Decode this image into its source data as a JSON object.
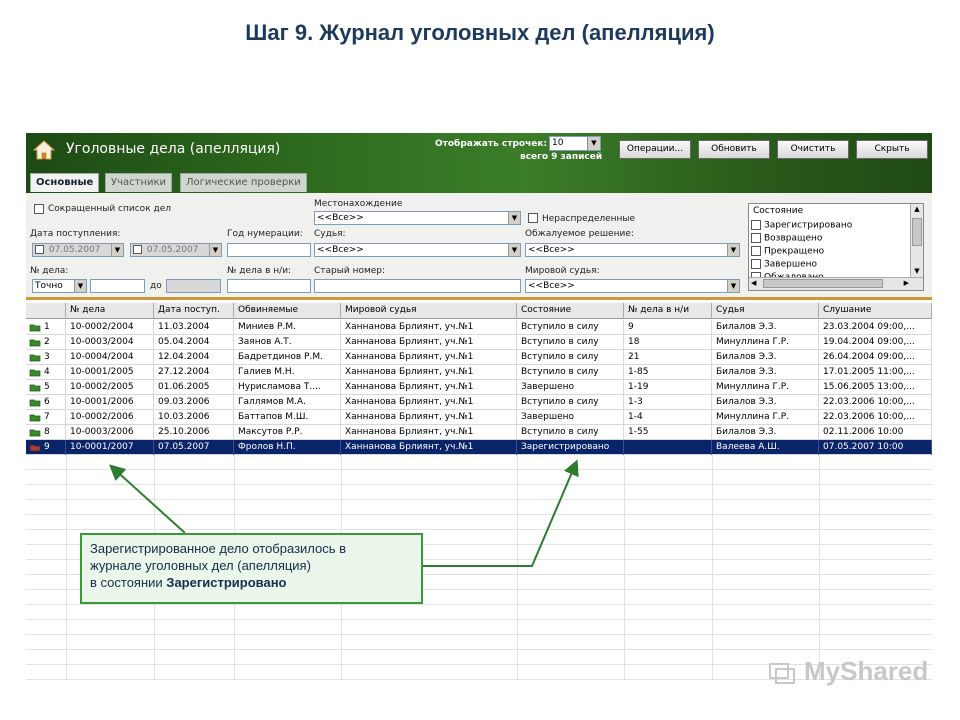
{
  "slide": {
    "title": "Шаг 9. Журнал уголовных дел (апелляция)"
  },
  "header": {
    "title": "Уголовные дела (апелляция)",
    "rows_label": "Отображать строчек:",
    "rows_value": "10",
    "records_count": "всего 9 записей",
    "buttons": [
      "Операции...",
      "Обновить",
      "Очистить",
      "Скрыть"
    ]
  },
  "tabs": [
    "Основные",
    "Участники",
    "Логические проверки"
  ],
  "filters": {
    "short_list": "Сокращенный список дел",
    "location_label": "Местонахождение",
    "location_value": "<<Все>>",
    "unassigned": "Нераспределенные",
    "date_label": "Дата поступления:",
    "date_from": "07.05.2007",
    "date_to": "07.05.2007",
    "year_label": "Год нумерации:",
    "judge_label": "Судья:",
    "judge_value": "<<Все>>",
    "decision_label": "Обжалуемое решение:",
    "decision_value": "<<Все>>",
    "case_no_label": "№ дела:",
    "match_value": "Точно",
    "to_label": "до",
    "case_no_nn_label": "№ дела в н/и:",
    "old_no_label": "Старый номер:",
    "magistrate_label": "Мировой судья:",
    "magistrate_value": "<<Все>>",
    "state_label": "Состояние",
    "states": [
      "Зарегистрировано",
      "Возвращено",
      "Прекращено",
      "Завершено",
      "Обжаловано"
    ]
  },
  "grid": {
    "columns": [
      "№ дела",
      "Дата поступ.",
      "Обвиняемые",
      "Мировой судья",
      "Состояние",
      "№ дела в н/и",
      "Судья",
      "Слушание"
    ],
    "rows": [
      {
        "n": "1",
        "case": "10-0002/2004",
        "date": "11.03.2004",
        "accused": "Миниев Р.М.",
        "magistrate": "Ханнанова Брлиянт, уч.№1",
        "state": "Вступило в силу",
        "nn": "9",
        "judge": "Билалов Э.З.",
        "hearing": "23.03.2004 09:00,..."
      },
      {
        "n": "2",
        "case": "10-0003/2004",
        "date": "05.04.2004",
        "accused": "Заянов А.Т.",
        "magistrate": "Ханнанова Брлиянт, уч.№1",
        "state": "Вступило в силу",
        "nn": "18",
        "judge": "Минуллина Г.Р.",
        "hearing": "19.04.2004 09:00,..."
      },
      {
        "n": "3",
        "case": "10-0004/2004",
        "date": "12.04.2004",
        "accused": "Бадретдинов Р.М.",
        "magistrate": "Ханнанова Брлиянт, уч.№1",
        "state": "Вступило в силу",
        "nn": "21",
        "judge": "Билалов Э.З.",
        "hearing": "26.04.2004 09:00,..."
      },
      {
        "n": "4",
        "case": "10-0001/2005",
        "date": "27.12.2004",
        "accused": "Галиев М.Н.",
        "magistrate": "Ханнанова Брлиянт, уч.№1",
        "state": "Вступило в силу",
        "nn": "1-85",
        "judge": "Билалов Э.З.",
        "hearing": "17.01.2005 11:00,..."
      },
      {
        "n": "5",
        "case": "10-0002/2005",
        "date": "01.06.2005",
        "accused": "Нурисламова Т....",
        "magistrate": "Ханнанова Брлиянт, уч.№1",
        "state": "Завершено",
        "nn": "1-19",
        "judge": "Минуллина Г.Р.",
        "hearing": "15.06.2005 13:00,..."
      },
      {
        "n": "6",
        "case": "10-0001/2006",
        "date": "09.03.2006",
        "accused": "Галлямов М.А.",
        "magistrate": "Ханнанова Брлиянт, уч.№1",
        "state": "Вступило в силу",
        "nn": "1-3",
        "judge": "Билалов Э.З.",
        "hearing": "22.03.2006 10:00,..."
      },
      {
        "n": "7",
        "case": "10-0002/2006",
        "date": "10.03.2006",
        "accused": "Баттапов М.Ш.",
        "magistrate": "Ханнанова Брлиянт, уч.№1",
        "state": "Завершено",
        "nn": "1-4",
        "judge": "Минуллина Г.Р.",
        "hearing": "22.03.2006 10:00,..."
      },
      {
        "n": "8",
        "case": "10-0003/2006",
        "date": "25.10.2006",
        "accused": "Максутов Р.Р.",
        "magistrate": "Ханнанова Брлиянт, уч.№1",
        "state": "Вступило в силу",
        "nn": "1-55",
        "judge": "Билалов Э.З.",
        "hearing": "02.11.2006 10:00"
      },
      {
        "n": "9",
        "case": "10-0001/2007",
        "date": "07.05.2007",
        "accused": "Фролов Н.П.",
        "magistrate": "Ханнанова Брлиянт, уч.№1",
        "state": "Зарегистрировано",
        "nn": "",
        "judge": "Валеева А.Ш.",
        "hearing": "07.05.2007 10:00"
      }
    ]
  },
  "callout": {
    "line1": "Зарегистрированное дело отобразилось в",
    "line2": "журнале уголовных дел (апелляция)",
    "line3": "в состоянии ",
    "line3_bold": "Зарегистрировано"
  },
  "watermark": "MyShared",
  "colors": {
    "header_green": "#2d6a1e",
    "selected_row": "#0a246a",
    "callout_border": "#3a9a3a",
    "title_color": "#1c3a5c"
  }
}
